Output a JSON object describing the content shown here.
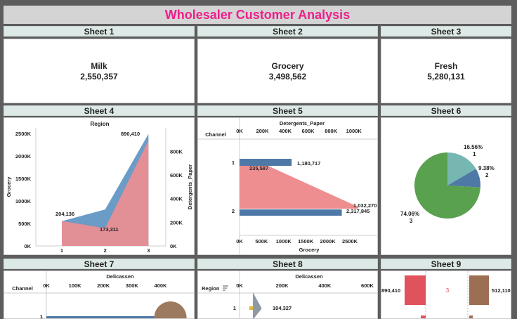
{
  "dashboard": {
    "title": "Wholesaler Customer Analysis"
  },
  "sheets": [
    {
      "label": "Sheet 1"
    },
    {
      "label": "Sheet 2"
    },
    {
      "label": "Sheet 3"
    },
    {
      "label": "Sheet 4"
    },
    {
      "label": "Sheet 5"
    },
    {
      "label": "Sheet 6"
    },
    {
      "label": "Sheet 7"
    },
    {
      "label": "Sheet 8"
    },
    {
      "label": "Sheet 9"
    }
  ],
  "kpis": [
    {
      "name": "Milk",
      "value": "2,550,357"
    },
    {
      "name": "Grocery",
      "value": "3,498,562"
    },
    {
      "name": "Fresh",
      "value": "5,280,131"
    }
  ],
  "chart_data": [
    {
      "sheet": "Sheet 4",
      "type": "area",
      "title": "Region",
      "x": [
        1,
        2,
        3
      ],
      "xlim": [
        0.4,
        3.4
      ],
      "series": [
        {
          "name": "Grocery",
          "axis": "left",
          "values": [
            550000,
            810000,
            2490000
          ],
          "color": "#6b9bc7"
        },
        {
          "name": "Detergents_Paper",
          "axis": "right",
          "values": [
            210000,
            150000,
            890410
          ],
          "color": "#ef8e90"
        }
      ],
      "ylabel": "Grocery",
      "ylabel_right": "Detergents_Paper",
      "yticks_left": [
        "2500K",
        "2000K",
        "1500K",
        "1000K",
        "500K",
        "0K"
      ],
      "ylim_left": [
        0,
        2500000
      ],
      "yticks_right": [
        "800K",
        "600K",
        "400K",
        "200K",
        "0K"
      ],
      "ylim_right": [
        0,
        950000
      ],
      "labels": [
        "890,410",
        "204,136",
        "173,311"
      ]
    },
    {
      "sheet": "Sheet 5",
      "type": "bar",
      "title": "Detergents_Paper",
      "row_header": "Channel",
      "categories": [
        "1",
        "2"
      ],
      "top_ticks": [
        "0K",
        "200K",
        "400K",
        "600K",
        "800K",
        "1000K"
      ],
      "xlim_top": [
        0,
        1100000
      ],
      "bottom_ticks": [
        "0K",
        "500K",
        "1000K",
        "1500K",
        "2000K",
        "2500K"
      ],
      "xlim_bottom": [
        0,
        2850000
      ],
      "xlabel": "Grocery",
      "series": [
        {
          "name": "Detergents_Paper",
          "values": [
            235587,
            1032270
          ],
          "color": "#ef8e90"
        },
        {
          "name": "Grocery",
          "values": [
            1180717,
            2317845
          ],
          "color": "#4e79a7"
        }
      ],
      "labels": [
        "1,180,717",
        "235,587",
        "1,032,270",
        "2,317,845"
      ]
    },
    {
      "sheet": "Sheet 6",
      "type": "pie",
      "slices": [
        {
          "label": "16.56%",
          "sub": "1",
          "value": 16.56,
          "color": "#76b7b2"
        },
        {
          "label": "9.38%",
          "sub": "2",
          "value": 9.38,
          "color": "#4e79a7"
        },
        {
          "label": "74.06%",
          "sub": "3",
          "value": 74.06,
          "color": "#59a14f"
        }
      ]
    },
    {
      "sheet": "Sheet 7",
      "type": "bar",
      "title": "Delicassen",
      "row_header": "Channel",
      "ticks": [
        "0K",
        "100K",
        "200K",
        "300K",
        "400K"
      ],
      "xlim": [
        0,
        480000
      ],
      "categories": [
        "1"
      ],
      "values": [
        410000
      ],
      "colors": [
        "#4e79a7",
        "#9c7a5f"
      ]
    },
    {
      "sheet": "Sheet 8",
      "type": "bar",
      "title": "Delicassen",
      "row_header": "Region",
      "sort_icon": "sort-icon",
      "ticks": [
        "0K",
        "200K",
        "400K",
        "600K"
      ],
      "xlim": [
        0,
        620000
      ],
      "categories": [
        "1"
      ],
      "values": [
        104327
      ],
      "labels": [
        "104,327"
      ],
      "colors": [
        "#e2b93b",
        "#8f99a3"
      ]
    },
    {
      "sheet": "Sheet 9",
      "type": "bar",
      "labels": [
        "890,410",
        "3",
        "512,110"
      ],
      "colors": [
        "#e0525c",
        "#9c6f55"
      ]
    }
  ]
}
